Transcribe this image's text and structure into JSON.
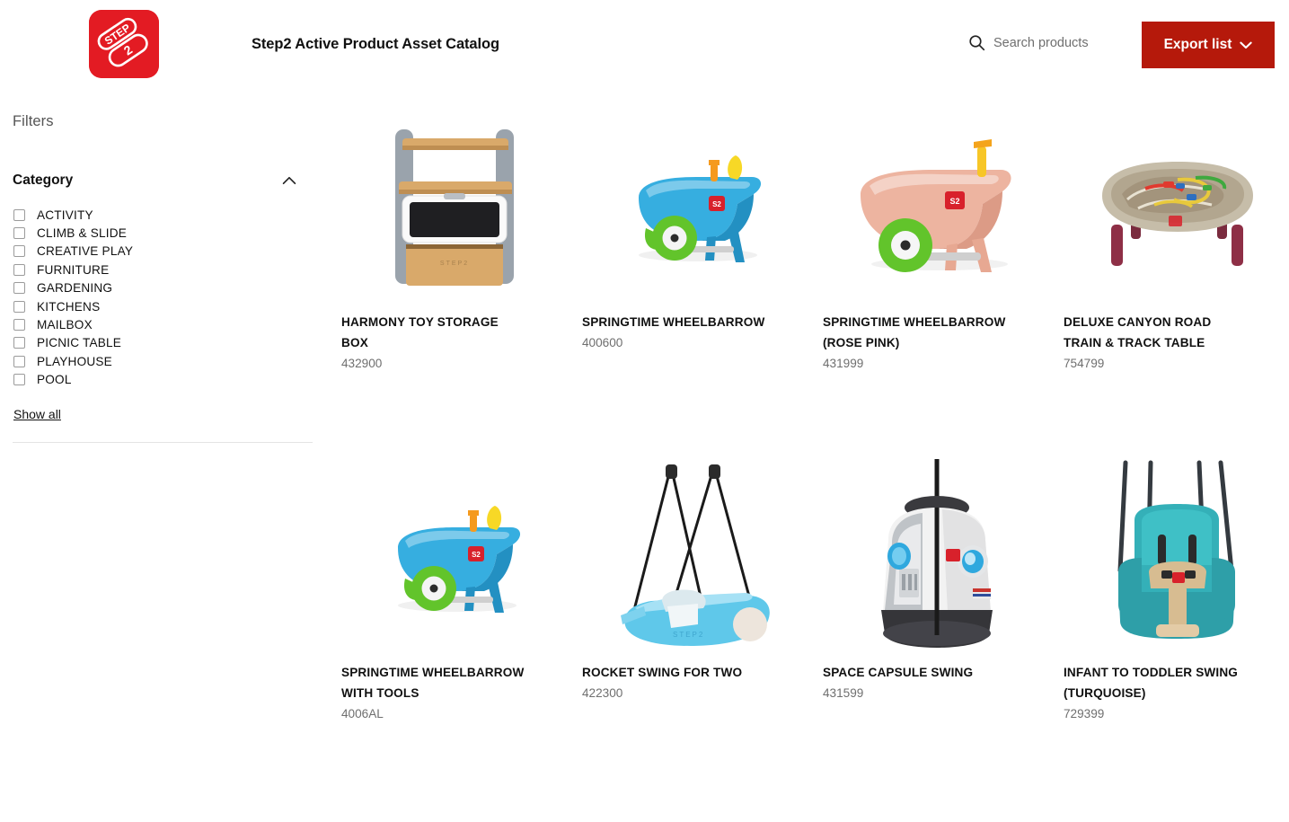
{
  "header": {
    "logo_text": "STEP2",
    "logo_color": "#E31B23",
    "title": "Step2 Active Product Asset Catalog",
    "search": {
      "icon": "search-icon",
      "placeholder": "Search products",
      "value": ""
    },
    "export": {
      "label": "Export list",
      "icon": "chevron-down-icon",
      "color": "#B5190B"
    }
  },
  "sidebar": {
    "filters_label": "Filters",
    "category": {
      "label": "Category",
      "collapse_icon": "chevron-up-icon",
      "expanded": true,
      "options": [
        {
          "label": "ACTIVITY",
          "checked": false
        },
        {
          "label": "CLIMB & SLIDE",
          "checked": false
        },
        {
          "label": "CREATIVE PLAY",
          "checked": false
        },
        {
          "label": "FURNITURE",
          "checked": false
        },
        {
          "label": "GARDENING",
          "checked": false
        },
        {
          "label": "KITCHENS",
          "checked": false
        },
        {
          "label": "MAILBOX",
          "checked": false
        },
        {
          "label": "PICNIC TABLE",
          "checked": false
        },
        {
          "label": "PLAYHOUSE",
          "checked": false
        },
        {
          "label": "POOL",
          "checked": false
        }
      ],
      "show_all_label": "Show all"
    }
  },
  "products": [
    {
      "title": "HARMONY TOY STORAGE BOX",
      "sku": "432900",
      "image": "toy-storage-box"
    },
    {
      "title": "SPRINGTIME WHEELBARROW",
      "sku": "400600",
      "image": "wheelbarrow-blue"
    },
    {
      "title": "SPRINGTIME WHEELBARROW (ROSE PINK)",
      "sku": "431999",
      "image": "wheelbarrow-rose-pink"
    },
    {
      "title": "DELUXE CANYON ROAD TRAIN & TRACK TABLE",
      "sku": "754799",
      "image": "train-track-table"
    },
    {
      "title": "SPRINGTIME WHEELBARROW WITH TOOLS",
      "sku": "4006AL",
      "image": "wheelbarrow-blue-tools"
    },
    {
      "title": "ROCKET SWING FOR TWO",
      "sku": "422300",
      "image": "rocket-swing"
    },
    {
      "title": "SPACE CAPSULE SWING",
      "sku": "431599",
      "image": "space-capsule-swing"
    },
    {
      "title": "INFANT TO TODDLER SWING (TURQUOISE)",
      "sku": "729399",
      "image": "infant-toddler-swing"
    }
  ]
}
